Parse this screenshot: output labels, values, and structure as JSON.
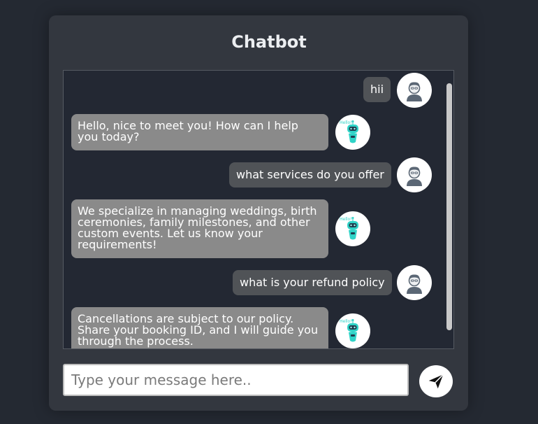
{
  "app": {
    "title": "Chatbot"
  },
  "messages": [
    {
      "sender": "user",
      "text": "hii"
    },
    {
      "sender": "bot",
      "text": "Hello, nice to meet you! How can I help you today?"
    },
    {
      "sender": "user",
      "text": "what services do you offer"
    },
    {
      "sender": "bot",
      "text": "We specialize in managing weddings, birth ceremonies, family milestones, and other custom events. Let us know your requirements!"
    },
    {
      "sender": "user",
      "text": "what is your refund policy"
    },
    {
      "sender": "bot",
      "text": "Cancellations are subject to our policy. Share your booking ID, and I will guide you through the process."
    }
  ],
  "bot_avatar": {
    "badge_text": "Hello!"
  },
  "input": {
    "placeholder": "Type your message here..",
    "value": ""
  },
  "send_button": {
    "icon": "send-icon"
  },
  "colors": {
    "page_bg": "#242932",
    "card_bg": "#33373f",
    "chat_bg": "#232833",
    "bot_bubble": "#8a8a8a",
    "user_bubble": "#505357",
    "bot_accent": "#2fd3c7"
  }
}
